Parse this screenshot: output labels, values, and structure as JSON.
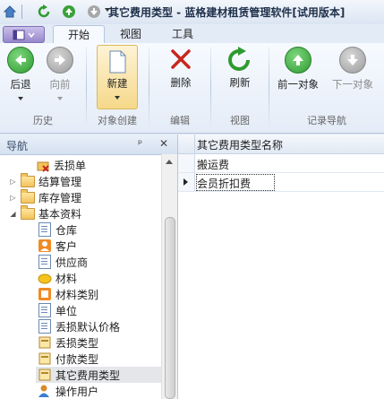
{
  "window": {
    "title": "其它费用类型 - 蓝格建材租赁管理软件[试用版本]"
  },
  "tabs": [
    "开始",
    "视图",
    "工具"
  ],
  "ribbon": {
    "buttons": {
      "back": "后退",
      "forward": "向前",
      "new": "新建",
      "delete": "删除",
      "refresh": "刷新",
      "prev": "前一对象",
      "next": "下一对象"
    },
    "groups": {
      "history": "历史",
      "create": "对象创建",
      "edit": "编辑",
      "view": "视图",
      "record_nav": "记录导航"
    }
  },
  "nav": {
    "title": "导航",
    "pin": "ᵖ",
    "close": "✕",
    "items": [
      {
        "label": "丢损单"
      },
      {
        "label": "结算管理"
      },
      {
        "label": "库存管理"
      },
      {
        "label": "基本资料"
      },
      {
        "label": "仓库"
      },
      {
        "label": "客户"
      },
      {
        "label": "供应商"
      },
      {
        "label": "材料"
      },
      {
        "label": "材料类别"
      },
      {
        "label": "单位"
      },
      {
        "label": "丢损默认价格"
      },
      {
        "label": "丢损类型"
      },
      {
        "label": "付款类型"
      },
      {
        "label": "其它费用类型"
      },
      {
        "label": "操作用户"
      }
    ]
  },
  "grid": {
    "header": "其它费用类型名称",
    "rows": [
      "搬运费",
      "会员折扣费"
    ]
  },
  "colors": {
    "accent": "#3a7fd0",
    "green": "#3aa13a",
    "red": "#c8261e"
  }
}
